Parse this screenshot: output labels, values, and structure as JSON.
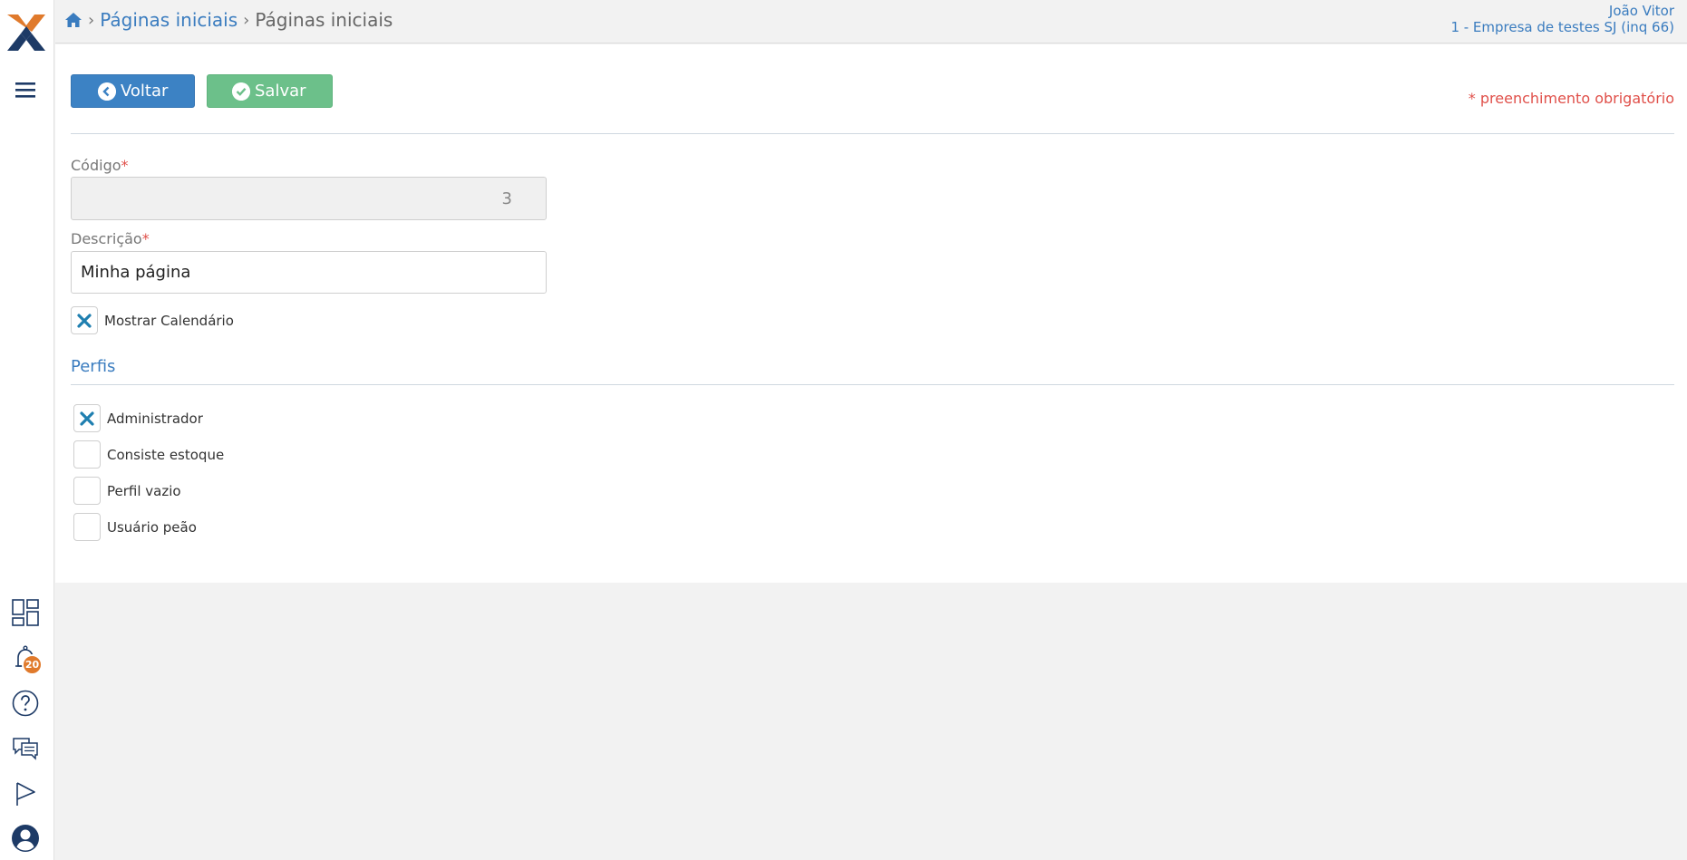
{
  "breadcrumb": {
    "items": [
      "Páginas iniciais",
      "Páginas iniciais"
    ]
  },
  "user": {
    "name": "João Vitor",
    "company": "1 - Empresa de testes SJ (inq 66)"
  },
  "toolbar": {
    "back_label": "Voltar",
    "save_label": "Salvar",
    "required_note": "* preenchimento obrigatório"
  },
  "form": {
    "codigo_label": "Código",
    "codigo_value": "3",
    "descricao_label": "Descrição",
    "descricao_value": "Minha página",
    "required_mark": "*",
    "mostrar_calendario_label": "Mostrar Calendário",
    "mostrar_calendario_checked": true
  },
  "perfis": {
    "title": "Perfis",
    "items": [
      {
        "label": "Administrador",
        "checked": true
      },
      {
        "label": "Consiste estoque",
        "checked": false
      },
      {
        "label": "Perfil vazio",
        "checked": false
      },
      {
        "label": "Usuário peão",
        "checked": false
      }
    ]
  },
  "notifications": {
    "count": "20"
  },
  "colors": {
    "primary": "#3c82c4",
    "success": "#6cc08a",
    "danger": "#e0504a",
    "brand_orange": "#e07a2c",
    "brand_navy": "#1d3a66",
    "check_teal": "#1f7fb0"
  },
  "icons": {
    "sidebar": [
      "menu-icon",
      "dashboard-icon",
      "bell-icon",
      "help-icon",
      "chat-icon",
      "flag-icon",
      "user-icon"
    ],
    "breadcrumb": "home-icon",
    "back": "chevron-left-circle-icon",
    "save": "check-circle-icon"
  }
}
